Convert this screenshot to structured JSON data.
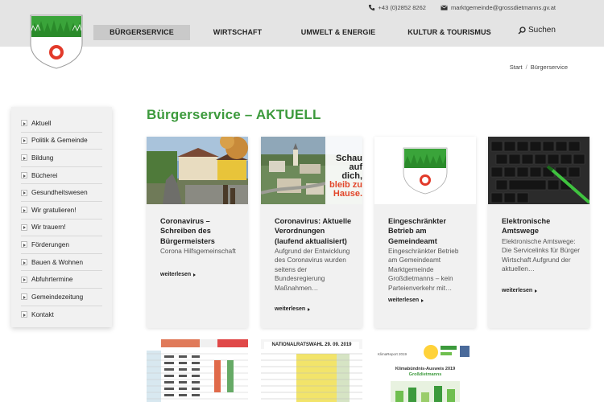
{
  "header": {
    "phone": "+43 (0)2852 8262",
    "email": "marktgemeinde@grossdietmanns.gv.at",
    "nav": [
      "BÜRGERSERVICE",
      "WIRTSCHAFT",
      "UMWELT & ENERGIE",
      "KULTUR & TOURISMUS"
    ],
    "nav_active": "BÜRGERSERVICE",
    "search_label": "Suchen"
  },
  "breadcrumb": [
    "Start",
    "Bürgerservice"
  ],
  "sidebar": {
    "items": [
      "Aktuell",
      "Politik & Gemeinde",
      "Bildung",
      "Bücherei",
      "Gesundheitswesen",
      "Wir gratulieren!",
      "Wir trauern!",
      "Förderungen",
      "Bauen & Wohnen",
      "Abfuhrtermine",
      "Gemeindezeitung",
      "Kontakt"
    ]
  },
  "main": {
    "title": "Bürgerservice – AKTUELL",
    "cards": [
      {
        "title": "Coronavirus – Schreiben des Bürgermeisters",
        "text": "Corona Hilfsgemeinschaft",
        "more": "weiterlesen"
      },
      {
        "title": "Coronavirus: Aktuelle Verordnungen (laufend aktualisiert)",
        "text": "Aufgrund der Entwicklung des Coronavirus wurden seitens der Bundesregierung Maßnahmen…",
        "more": "weiterlesen",
        "overlay": [
          "Schau",
          "auf dich,",
          "bleib zu",
          "Hause."
        ]
      },
      {
        "title": "Eingeschränkter Betrieb am Gemeindeamt",
        "text": "Eingeschränkter Betrieb am Gemeindeamt Marktgemeinde Großdietmanns – kein Parteienverkehr mit…",
        "more": "weiterlesen"
      },
      {
        "title": "Elektronische Amtswege",
        "text": "Elektronische Amtswege: Die Servicelinks für Bürger Wirtschaft Aufgrund der aktuellen…",
        "more": "weiterlesen"
      }
    ],
    "row2": {
      "election_title": "NATIONALRATSWAHL 29. 09. 2019",
      "climate_title": "Klimabündnis-Ausweis 2019",
      "climate_sub": "Großdietmanns",
      "climate_report": "KlimaReport 2019"
    }
  },
  "colors": {
    "accent": "#3c9a3c",
    "header_bg": "#e4e4e4",
    "sidebar_bg": "#f1f1f1",
    "card_bg": "#f1f1f1"
  }
}
